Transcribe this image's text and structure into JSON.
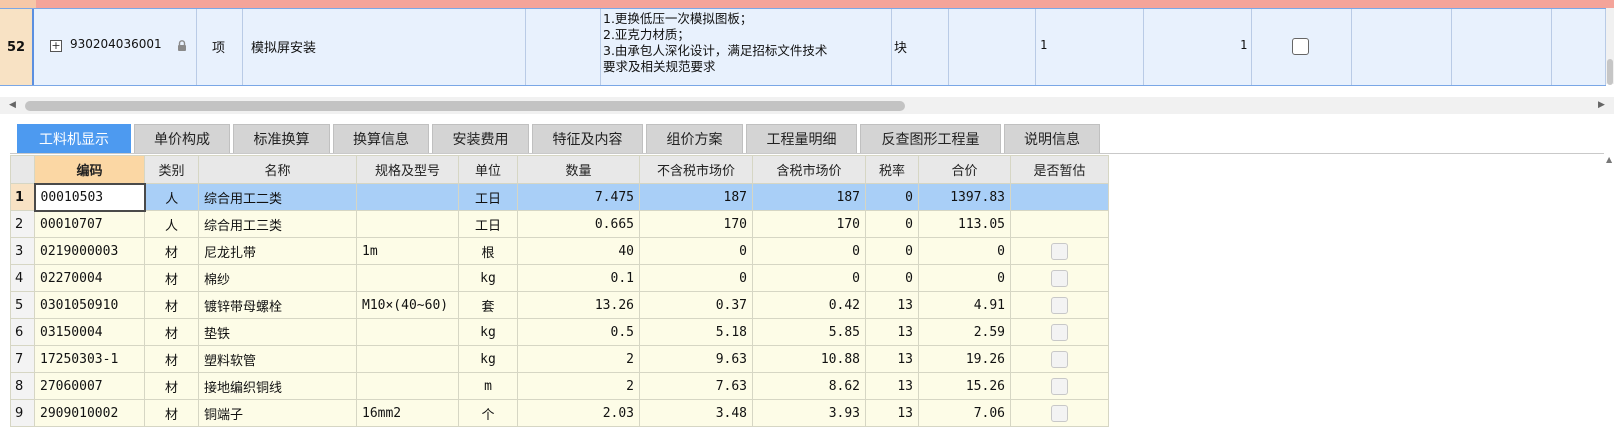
{
  "top_row": {
    "row_number": "52",
    "code": "930204036001",
    "type": "项",
    "name": "模拟屏安装",
    "description": [
      "1.更换低压一次模拟图板；",
      "2.亚克力材质；",
      "3.由承包人深化设计，满足招标文件技术",
      "要求及相关规范要求"
    ],
    "unit": "块",
    "quantity_expr": "1",
    "quantity": "1"
  },
  "tabs": [
    {
      "label": "工料机显示",
      "active": true
    },
    {
      "label": "单价构成",
      "active": false
    },
    {
      "label": "标准换算",
      "active": false
    },
    {
      "label": "换算信息",
      "active": false
    },
    {
      "label": "安装费用",
      "active": false
    },
    {
      "label": "特征及内容",
      "active": false
    },
    {
      "label": "组价方案",
      "active": false
    },
    {
      "label": "工程量明细",
      "active": false
    },
    {
      "label": "反查图形工程量",
      "active": false
    },
    {
      "label": "说明信息",
      "active": false
    }
  ],
  "table": {
    "headers": [
      "编码",
      "类别",
      "名称",
      "规格及型号",
      "单位",
      "数量",
      "不含税市场价",
      "含税市场价",
      "税率",
      "合价",
      "是否暂估"
    ],
    "rows": [
      {
        "n": "1",
        "code": "00010503",
        "cat": "人",
        "name": "综合用工二类",
        "spec": "",
        "unit": "工日",
        "qty": "7.475",
        "price_ex": "187",
        "price_in": "187",
        "tax": "0",
        "total": "1397.83",
        "est": false
      },
      {
        "n": "2",
        "code": "00010707",
        "cat": "人",
        "name": "综合用工三类",
        "spec": "",
        "unit": "工日",
        "qty": "0.665",
        "price_ex": "170",
        "price_in": "170",
        "tax": "0",
        "total": "113.05",
        "est": false
      },
      {
        "n": "3",
        "code": "0219000003",
        "cat": "材",
        "name": "尼龙扎带",
        "spec": "1m",
        "unit": "根",
        "qty": "40",
        "price_ex": "0",
        "price_in": "0",
        "tax": "0",
        "total": "0",
        "est": true
      },
      {
        "n": "4",
        "code": "02270004",
        "cat": "材",
        "name": "棉纱",
        "spec": "",
        "unit": "kg",
        "qty": "0.1",
        "price_ex": "0",
        "price_in": "0",
        "tax": "0",
        "total": "0",
        "est": true
      },
      {
        "n": "5",
        "code": "0301050910",
        "cat": "材",
        "name": "镀锌带母螺栓",
        "spec": "M10×(40~60)",
        "unit": "套",
        "qty": "13.26",
        "price_ex": "0.37",
        "price_in": "0.42",
        "tax": "13",
        "total": "4.91",
        "est": true
      },
      {
        "n": "6",
        "code": "03150004",
        "cat": "材",
        "name": "垫铁",
        "spec": "",
        "unit": "kg",
        "qty": "0.5",
        "price_ex": "5.18",
        "price_in": "5.85",
        "tax": "13",
        "total": "2.59",
        "est": true
      },
      {
        "n": "7",
        "code": "17250303-1",
        "cat": "材",
        "name": "塑料软管",
        "spec": "",
        "unit": "kg",
        "qty": "2",
        "price_ex": "9.63",
        "price_in": "10.88",
        "tax": "13",
        "total": "19.26",
        "est": true
      },
      {
        "n": "8",
        "code": "27060007",
        "cat": "材",
        "name": "接地编织铜线",
        "spec": "",
        "unit": "m",
        "qty": "2",
        "price_ex": "7.63",
        "price_in": "8.62",
        "tax": "13",
        "total": "15.26",
        "est": true
      },
      {
        "n": "9",
        "code": "2909010002",
        "cat": "材",
        "name": "铜端子",
        "spec": "16mm2",
        "unit": "个",
        "qty": "2.03",
        "price_ex": "3.48",
        "price_in": "3.93",
        "tax": "13",
        "total": "7.06",
        "est": true
      }
    ]
  },
  "icons": [
    "expand-plus-icon",
    "lock-icon",
    "checkbox-icon",
    "scroll-left-icon",
    "scroll-right-icon"
  ],
  "colors": {
    "active_tab": "#4d9af0",
    "selected_row": "#a9cff7",
    "top_row_bg": "#e8f1fd",
    "table_bg": "#fdfce7"
  }
}
